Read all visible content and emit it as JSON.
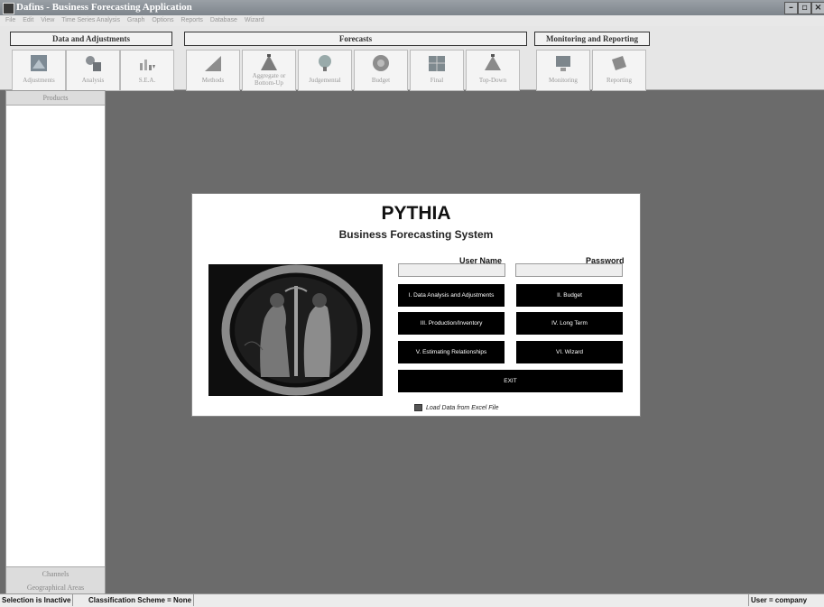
{
  "window": {
    "title": "Dafins - Business Forecasting Application"
  },
  "menu": [
    "File",
    "Edit",
    "View",
    "Time Series Analysis",
    "Graph",
    "Options",
    "Reports",
    "Database",
    "Wizard"
  ],
  "toolbar": {
    "groups": [
      {
        "title": "Data and Adjustments",
        "buttons": [
          "Adjustments",
          "Analysis",
          "S.E.A."
        ]
      },
      {
        "title": "Forecasts",
        "buttons": [
          "Methods",
          "Aggregate or Bottom-Up",
          "Judgemental",
          "Budget",
          "Final",
          "Top-Down"
        ]
      },
      {
        "title": "Monitoring and Reporting",
        "buttons": [
          "Monitoring",
          "Reporting"
        ]
      }
    ]
  },
  "sidebar": {
    "top": "Products",
    "bottom1": "Channels",
    "bottom2": "Geographical Areas"
  },
  "login": {
    "title": "PYTHIA",
    "subtitle": "Business Forecasting System",
    "username_label": "User Name",
    "password_label": "Password",
    "buttons": {
      "b1": "I. Data Analysis and Adjustments",
      "b2": "II. Budget",
      "b3": "III. Production/Inventory",
      "b4": "IV. Long Term",
      "b5": "V. Estimating Relationships",
      "b6": "VI. Wizard",
      "exit": "EXIT"
    },
    "excel_label": "Load Data from Excel File"
  },
  "status": {
    "selection": "Selection is Inactive",
    "scheme": "Classification Scheme = None",
    "user": "User = company"
  }
}
